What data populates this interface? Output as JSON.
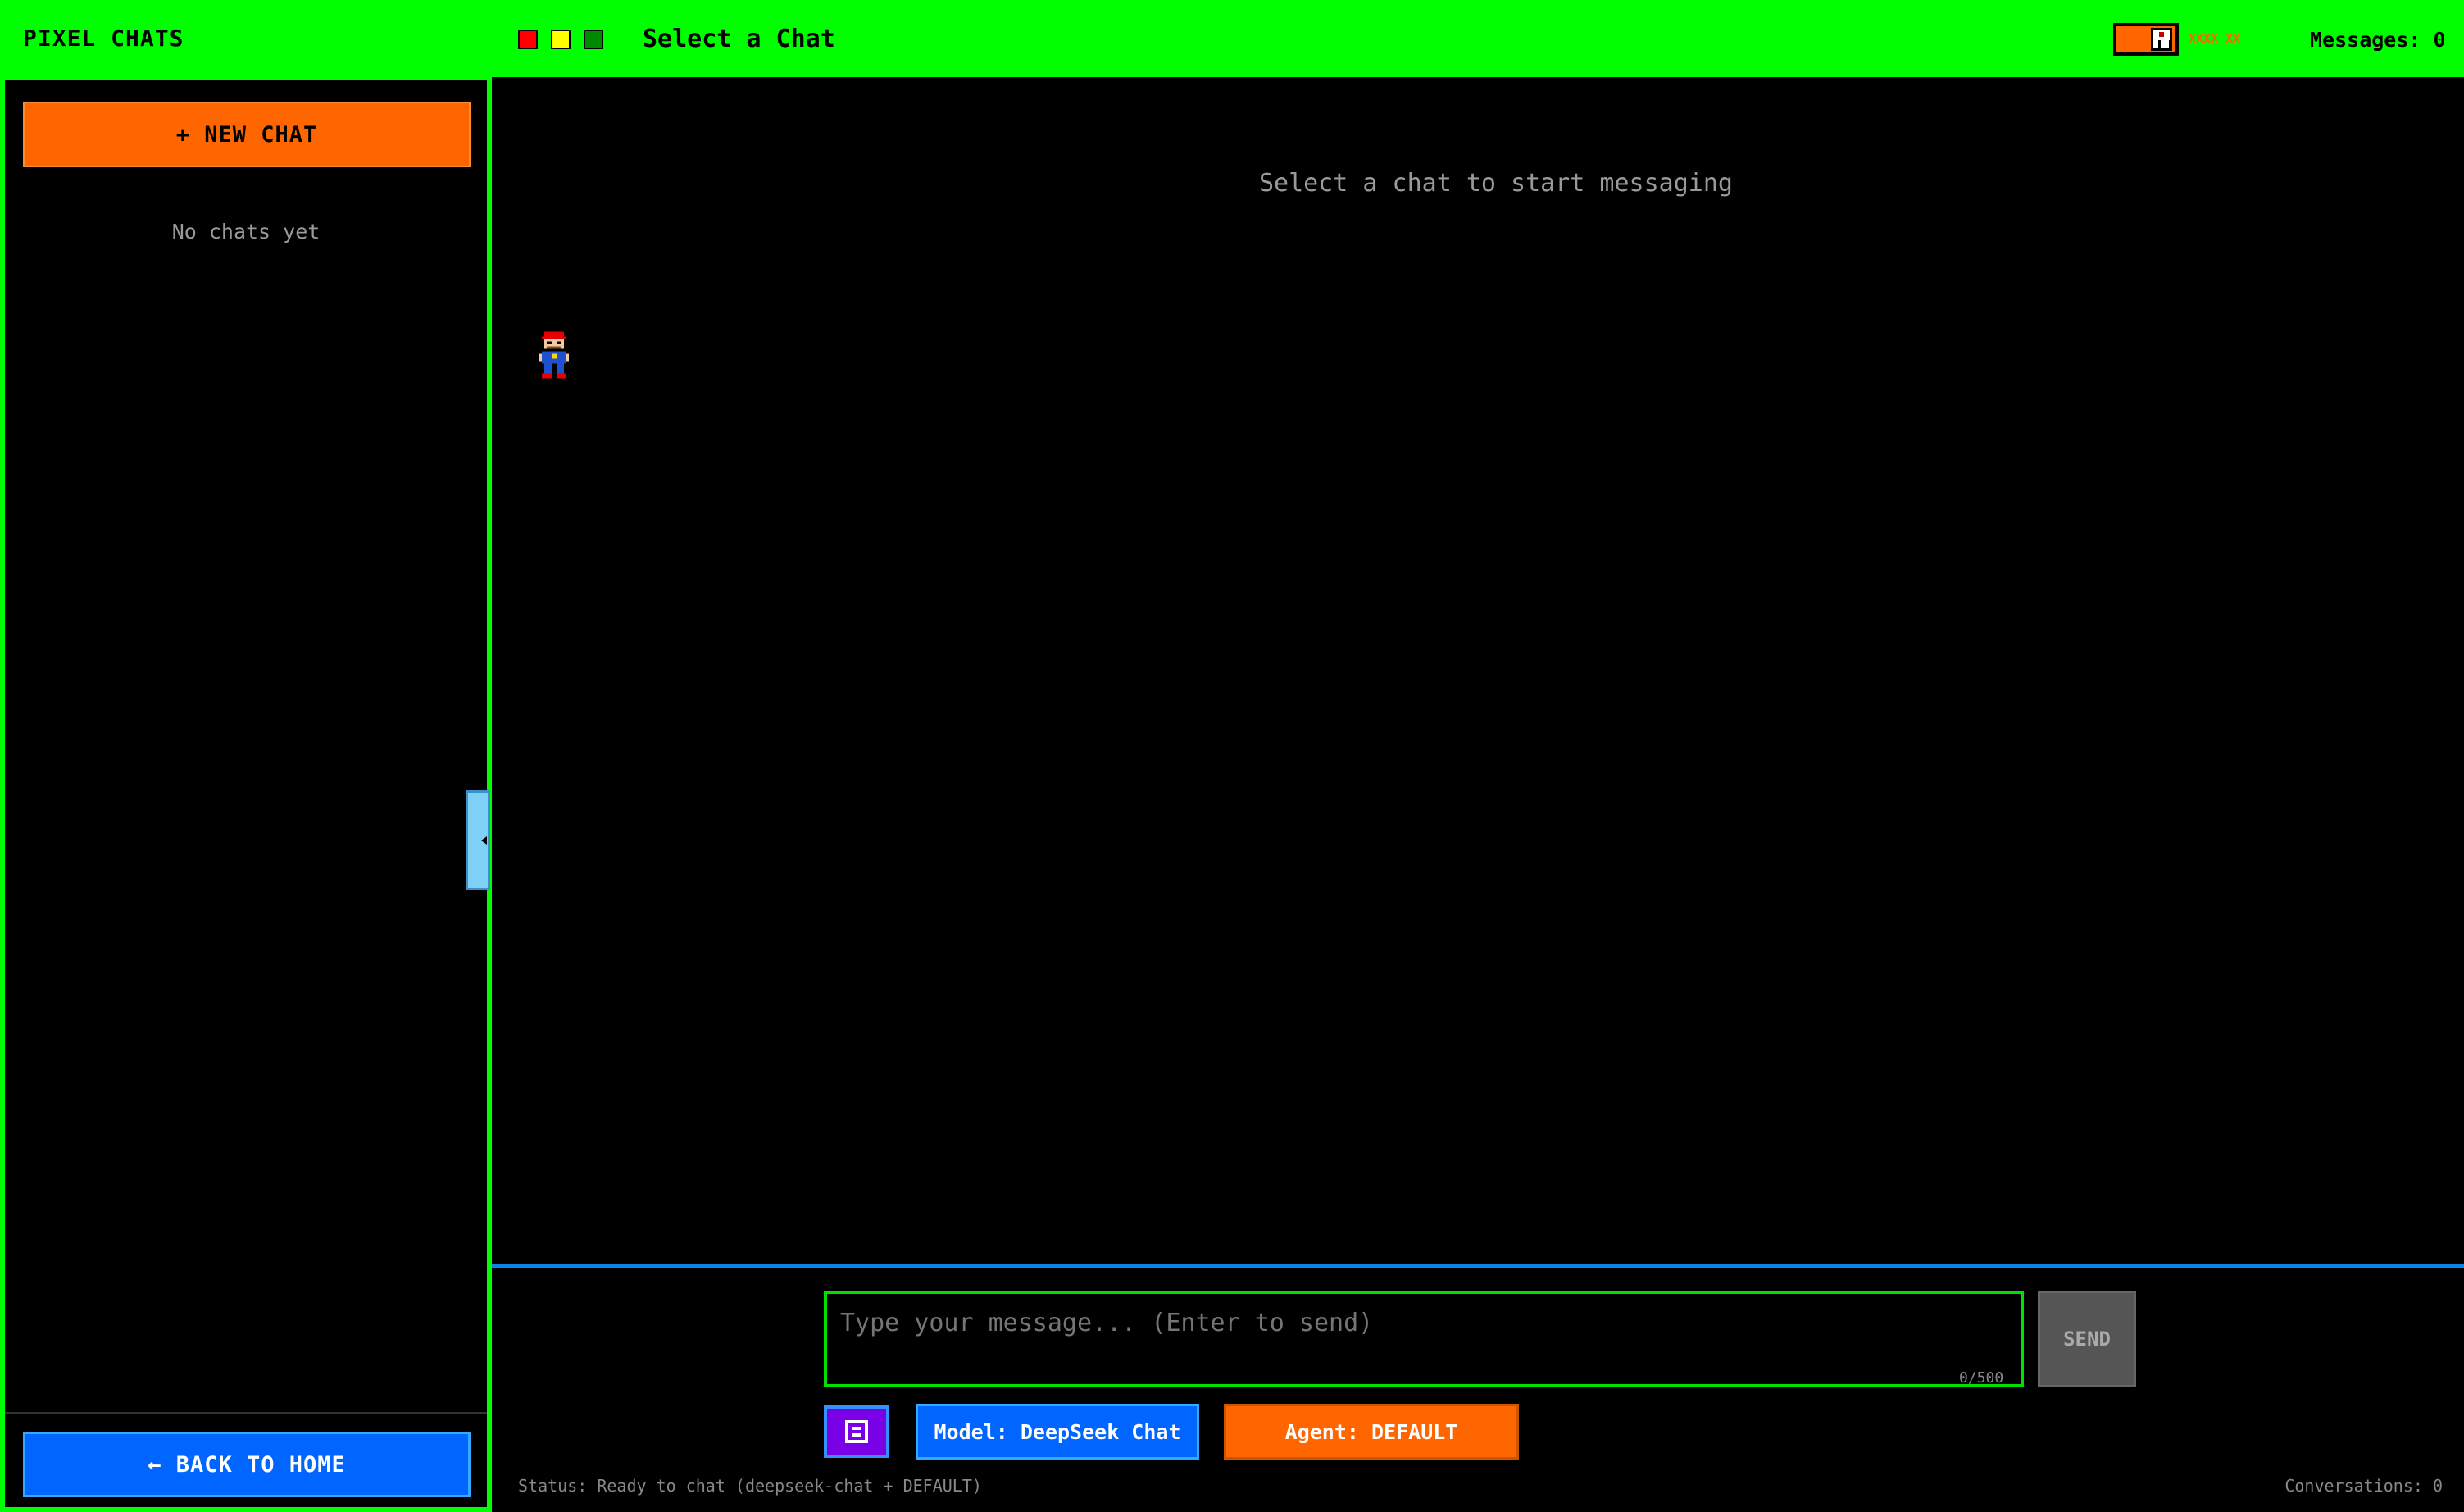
{
  "topbar": {
    "app_title": "PIXEL CHATS",
    "chat_title": "Select a Chat",
    "battery_label": "XXXX XX",
    "messages_count": "Messages: 0"
  },
  "sidebar": {
    "new_chat_label": "+ NEW CHAT",
    "empty_text": "No chats yet",
    "back_home_label": "← BACK TO HOME"
  },
  "main": {
    "empty_prompt": "Select a chat to start messaging"
  },
  "composer": {
    "placeholder": "Type your message... (Enter to send)",
    "char_count": "0/500",
    "send_label": "SEND",
    "model_label": "Model: DeepSeek Chat",
    "agent_label": "Agent: DEFAULT"
  },
  "footer": {
    "status": "Status: Ready to chat (deepseek-chat + DEFAULT)",
    "conversations": "Conversations: 0"
  },
  "icons": {
    "window_controls": [
      "red-square-icon",
      "yellow-square-icon",
      "green-square-icon"
    ],
    "battery": "battery-icon",
    "collapse": "collapse-sidebar-icon",
    "save": "save-icon",
    "mascot": "pixel-character-icon"
  },
  "colors": {
    "accent_green": "#00ff00",
    "accent_orange": "#ff6600",
    "accent_blue": "#0066ff",
    "accent_purple": "#7a00e6",
    "background": "#000000"
  }
}
